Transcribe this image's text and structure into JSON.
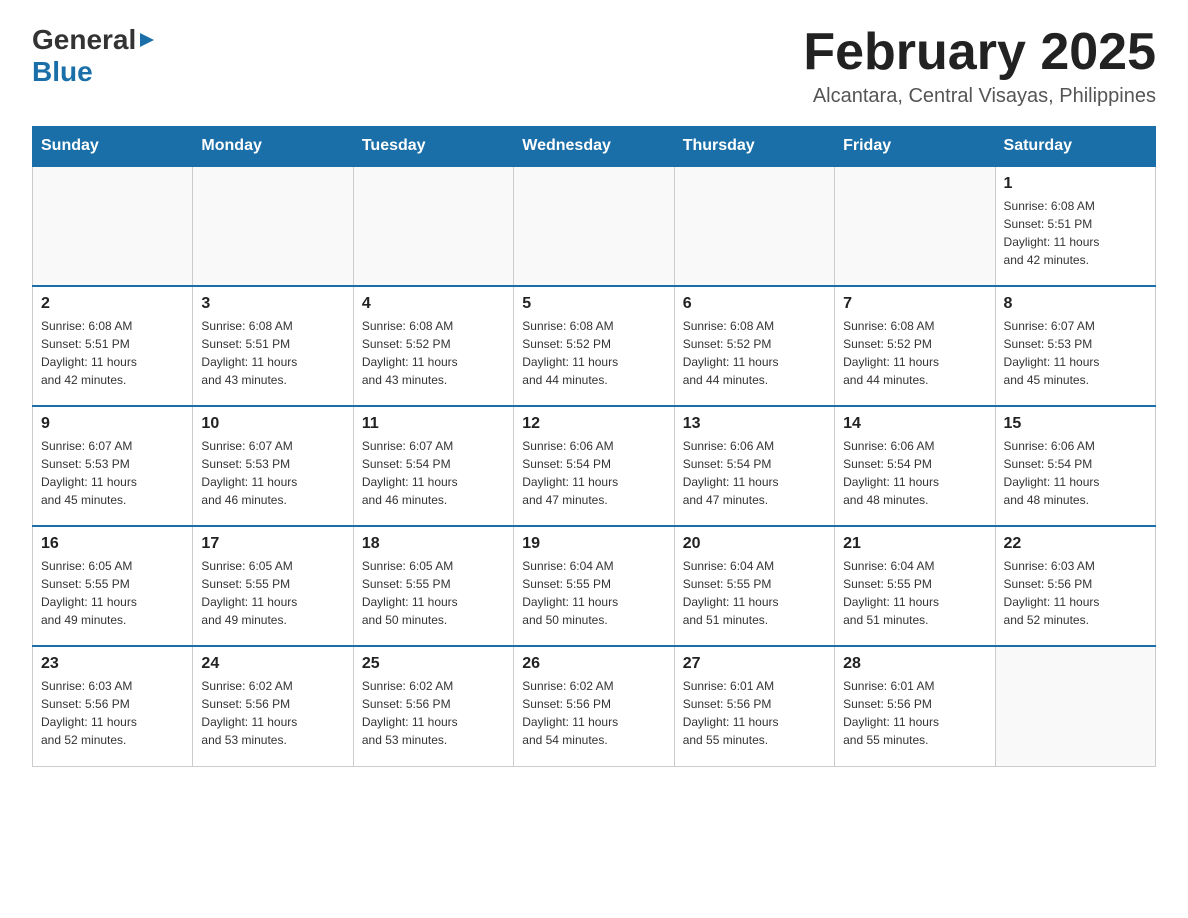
{
  "logo": {
    "general": "General",
    "blue": "Blue"
  },
  "title": "February 2025",
  "subtitle": "Alcantara, Central Visayas, Philippines",
  "weekdays": [
    "Sunday",
    "Monday",
    "Tuesday",
    "Wednesday",
    "Thursday",
    "Friday",
    "Saturday"
  ],
  "weeks": [
    [
      {
        "day": "",
        "info": ""
      },
      {
        "day": "",
        "info": ""
      },
      {
        "day": "",
        "info": ""
      },
      {
        "day": "",
        "info": ""
      },
      {
        "day": "",
        "info": ""
      },
      {
        "day": "",
        "info": ""
      },
      {
        "day": "1",
        "info": "Sunrise: 6:08 AM\nSunset: 5:51 PM\nDaylight: 11 hours\nand 42 minutes."
      }
    ],
    [
      {
        "day": "2",
        "info": "Sunrise: 6:08 AM\nSunset: 5:51 PM\nDaylight: 11 hours\nand 42 minutes."
      },
      {
        "day": "3",
        "info": "Sunrise: 6:08 AM\nSunset: 5:51 PM\nDaylight: 11 hours\nand 43 minutes."
      },
      {
        "day": "4",
        "info": "Sunrise: 6:08 AM\nSunset: 5:52 PM\nDaylight: 11 hours\nand 43 minutes."
      },
      {
        "day": "5",
        "info": "Sunrise: 6:08 AM\nSunset: 5:52 PM\nDaylight: 11 hours\nand 44 minutes."
      },
      {
        "day": "6",
        "info": "Sunrise: 6:08 AM\nSunset: 5:52 PM\nDaylight: 11 hours\nand 44 minutes."
      },
      {
        "day": "7",
        "info": "Sunrise: 6:08 AM\nSunset: 5:52 PM\nDaylight: 11 hours\nand 44 minutes."
      },
      {
        "day": "8",
        "info": "Sunrise: 6:07 AM\nSunset: 5:53 PM\nDaylight: 11 hours\nand 45 minutes."
      }
    ],
    [
      {
        "day": "9",
        "info": "Sunrise: 6:07 AM\nSunset: 5:53 PM\nDaylight: 11 hours\nand 45 minutes."
      },
      {
        "day": "10",
        "info": "Sunrise: 6:07 AM\nSunset: 5:53 PM\nDaylight: 11 hours\nand 46 minutes."
      },
      {
        "day": "11",
        "info": "Sunrise: 6:07 AM\nSunset: 5:54 PM\nDaylight: 11 hours\nand 46 minutes."
      },
      {
        "day": "12",
        "info": "Sunrise: 6:06 AM\nSunset: 5:54 PM\nDaylight: 11 hours\nand 47 minutes."
      },
      {
        "day": "13",
        "info": "Sunrise: 6:06 AM\nSunset: 5:54 PM\nDaylight: 11 hours\nand 47 minutes."
      },
      {
        "day": "14",
        "info": "Sunrise: 6:06 AM\nSunset: 5:54 PM\nDaylight: 11 hours\nand 48 minutes."
      },
      {
        "day": "15",
        "info": "Sunrise: 6:06 AM\nSunset: 5:54 PM\nDaylight: 11 hours\nand 48 minutes."
      }
    ],
    [
      {
        "day": "16",
        "info": "Sunrise: 6:05 AM\nSunset: 5:55 PM\nDaylight: 11 hours\nand 49 minutes."
      },
      {
        "day": "17",
        "info": "Sunrise: 6:05 AM\nSunset: 5:55 PM\nDaylight: 11 hours\nand 49 minutes."
      },
      {
        "day": "18",
        "info": "Sunrise: 6:05 AM\nSunset: 5:55 PM\nDaylight: 11 hours\nand 50 minutes."
      },
      {
        "day": "19",
        "info": "Sunrise: 6:04 AM\nSunset: 5:55 PM\nDaylight: 11 hours\nand 50 minutes."
      },
      {
        "day": "20",
        "info": "Sunrise: 6:04 AM\nSunset: 5:55 PM\nDaylight: 11 hours\nand 51 minutes."
      },
      {
        "day": "21",
        "info": "Sunrise: 6:04 AM\nSunset: 5:55 PM\nDaylight: 11 hours\nand 51 minutes."
      },
      {
        "day": "22",
        "info": "Sunrise: 6:03 AM\nSunset: 5:56 PM\nDaylight: 11 hours\nand 52 minutes."
      }
    ],
    [
      {
        "day": "23",
        "info": "Sunrise: 6:03 AM\nSunset: 5:56 PM\nDaylight: 11 hours\nand 52 minutes."
      },
      {
        "day": "24",
        "info": "Sunrise: 6:02 AM\nSunset: 5:56 PM\nDaylight: 11 hours\nand 53 minutes."
      },
      {
        "day": "25",
        "info": "Sunrise: 6:02 AM\nSunset: 5:56 PM\nDaylight: 11 hours\nand 53 minutes."
      },
      {
        "day": "26",
        "info": "Sunrise: 6:02 AM\nSunset: 5:56 PM\nDaylight: 11 hours\nand 54 minutes."
      },
      {
        "day": "27",
        "info": "Sunrise: 6:01 AM\nSunset: 5:56 PM\nDaylight: 11 hours\nand 55 minutes."
      },
      {
        "day": "28",
        "info": "Sunrise: 6:01 AM\nSunset: 5:56 PM\nDaylight: 11 hours\nand 55 minutes."
      },
      {
        "day": "",
        "info": ""
      }
    ]
  ]
}
